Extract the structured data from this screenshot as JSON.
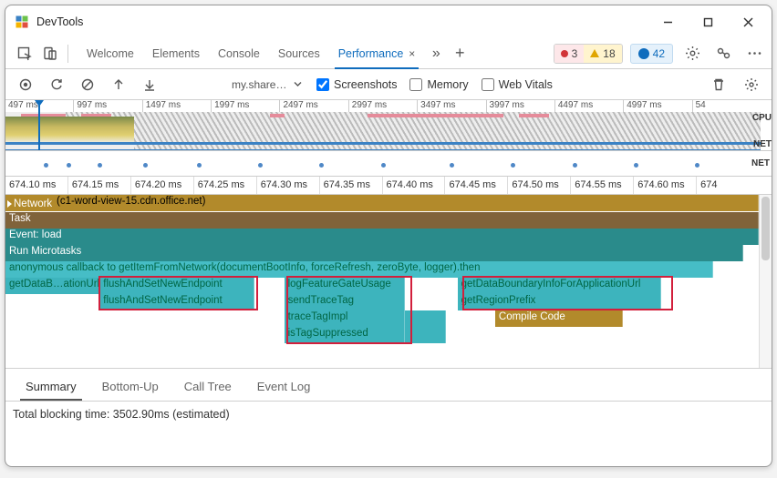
{
  "window": {
    "title": "DevTools"
  },
  "tabs": {
    "items": [
      "Welcome",
      "Elements",
      "Console",
      "Sources",
      "Performance"
    ],
    "active": 4,
    "close_glyph": "×",
    "chevrons_glyph": "»",
    "plus_glyph": "+"
  },
  "status_badges": {
    "errors": "3",
    "warnings": "18",
    "info": "42"
  },
  "subbar": {
    "url_selector": "my.sharep…",
    "checkbox_screenshots": {
      "label": "Screenshots",
      "checked": true
    },
    "checkbox_memory": {
      "label": "Memory",
      "checked": false
    },
    "checkbox_webvitals": {
      "label": "Web Vitals",
      "checked": false
    }
  },
  "overview": {
    "ticks": [
      "497 ms",
      "997 ms",
      "1497 ms",
      "1997 ms",
      "2497 ms",
      "2997 ms",
      "3497 ms",
      "3997 ms",
      "4497 ms",
      "4997 ms",
      "54"
    ],
    "label_cpu": "CPU",
    "label_net": "NET"
  },
  "netrow": {
    "label": "NET"
  },
  "ruler": {
    "ticks": [
      "674.10 ms",
      "674.15 ms",
      "674.20 ms",
      "674.25 ms",
      "674.30 ms",
      "674.35 ms",
      "674.40 ms",
      "674.45 ms",
      "674.50 ms",
      "674.55 ms",
      "674.60 ms",
      "674"
    ]
  },
  "flame": {
    "network_head": "Network",
    "network_file": "(c1-word-view-15.cdn.office.net)",
    "task": "Task",
    "event_load": "Event: load",
    "run_microtasks": "Run Microtasks",
    "anon_cb": "anonymous callback to getItemFromNetwork(documentBootInfo, forceRefresh, zeroByte, logger).then",
    "getDataB": "getDataB…ationUrl",
    "flush1": "flushAndSetNewEndpoint",
    "flush2": "flushAndSetNewEndpoint",
    "logFg": "logFeatureGateUsage",
    "sendTrace": "sendTraceTag",
    "traceImpl": "traceTagImpl",
    "isTag": "isTagSuppressed",
    "getDataBoundary": "getDataBoundaryInfoForApplicationUrl",
    "getRegion": "getRegionPrefix",
    "compile": "Compile Code"
  },
  "bottom_tabs": {
    "items": [
      "Summary",
      "Bottom-Up",
      "Call Tree",
      "Event Log"
    ],
    "active": 0
  },
  "footer": {
    "blocking_text": "Total blocking time: 3502.90ms (estimated)"
  }
}
